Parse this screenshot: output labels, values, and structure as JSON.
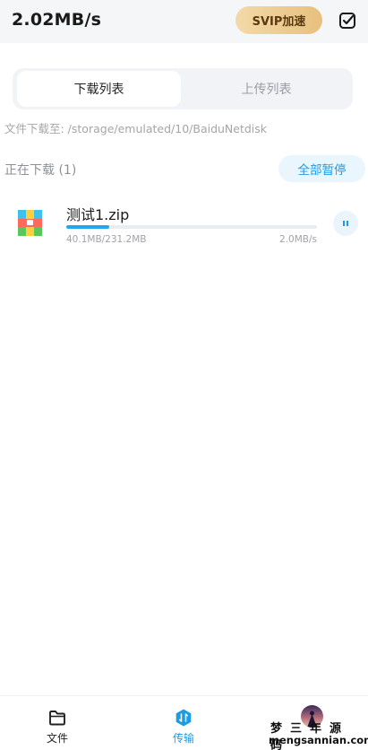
{
  "header": {
    "speed": "2.02MB/s",
    "svip_label": "SVIP加速"
  },
  "tabs": [
    {
      "label": "下载列表",
      "active": true
    },
    {
      "label": "上传列表",
      "active": false
    }
  ],
  "download_path": "文件下载至: /storage/emulated/10/BaiduNetdisk",
  "section": {
    "title": "正在下载 (1)",
    "pause_all_label": "全部暂停"
  },
  "downloads": [
    {
      "name": "测试1.zip",
      "size": "40.1MB/231.2MB",
      "rate": "2.0MB/s",
      "progress": 0.173,
      "icon": "zip-archive-icon"
    }
  ],
  "bottom_nav": [
    {
      "label": "文件",
      "icon": "folder-icon",
      "active": false
    },
    {
      "label": "传输",
      "icon": "transfer-icon",
      "active": true
    },
    {
      "label": "",
      "icon": "avatar",
      "active": false
    }
  ],
  "watermark": {
    "cn": "梦三年源码",
    "en": "mengsannian.com"
  },
  "colors": {
    "accent": "#1c9be6",
    "svip": "#e8c07e",
    "background_top": "#f5f6f8"
  }
}
